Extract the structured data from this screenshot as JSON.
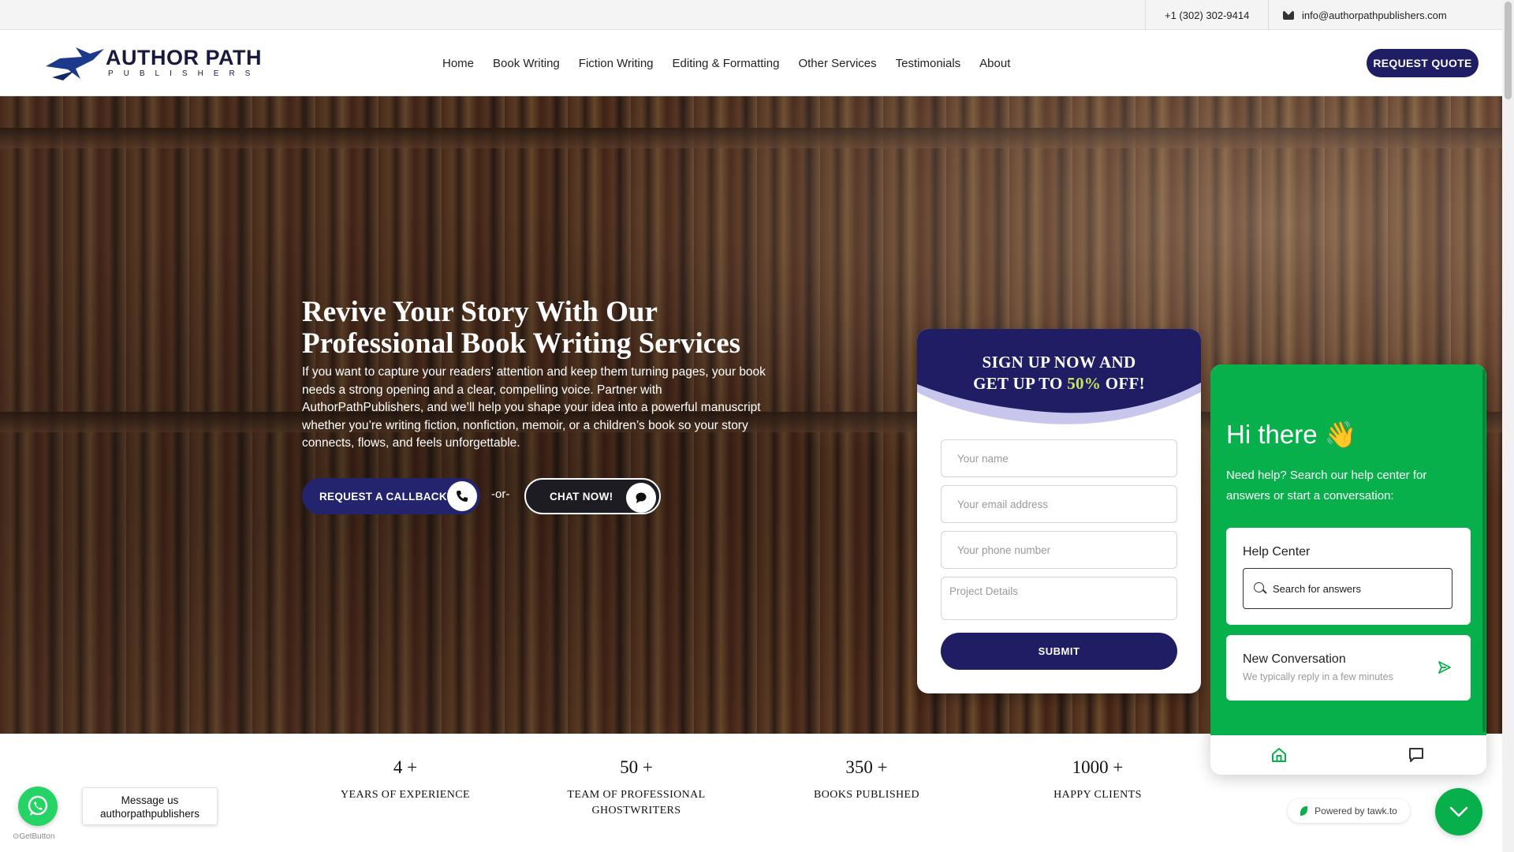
{
  "topbar": {
    "phone": "+1 (302) 302-9414",
    "email": "info@authorpathpublishers.com",
    "email_icon": "envelope-icon"
  },
  "header": {
    "logo_line1": "AUTHOR PATH",
    "logo_line2": "PUBLISHERS",
    "nav": [
      {
        "label": "Home"
      },
      {
        "label": "Book Writing"
      },
      {
        "label": "Fiction Writing"
      },
      {
        "label": "Editing & Formatting"
      },
      {
        "label": "Other Services"
      },
      {
        "label": "Testimonials"
      },
      {
        "label": "About"
      }
    ],
    "quote_button": "REQUEST QUOTE"
  },
  "hero": {
    "title": "Revive Your Story With Our Professional Book Writing Services",
    "description": "If you want to capture your readers’ attention and keep them turning pages, your book needs a strong opening and a clear, compelling voice. Partner with AuthorPathPublishers, and we’ll help you shape your idea into a powerful manuscript whether you’re writing fiction, nonfiction, memoir, or a children’s book so your story connects, flows, and feels unforgettable.",
    "callback_button": "REQUEST A CALLBACK",
    "or_text": "-or-",
    "chat_button": "CHAT NOW!"
  },
  "signup": {
    "title_line1": "SIGN UP NOW AND",
    "title_line2_pre": "GET UP TO ",
    "title_line2_pct": "50%",
    "title_line2_post": " OFF!",
    "name_placeholder": "Your name",
    "email_placeholder": "Your email address",
    "phone_placeholder": "Your phone number",
    "details_placeholder": "Project Details",
    "submit": "SUBMIT",
    "accent_color": "#1f1d63",
    "highlight_color": "#c8e65a"
  },
  "stats": [
    {
      "num": "4 +",
      "label": "YEARS OF EXPERIENCE"
    },
    {
      "num": "50 +",
      "label": "TEAM OF PROFESSIONAL GHOSTWRITERS"
    },
    {
      "num": "350 +",
      "label": "BOOKS PUBLISHED"
    },
    {
      "num": "1000 +",
      "label": "HAPPY CLIENTS"
    }
  ],
  "whatsapp": {
    "message_line1": "Message us",
    "message_line2": "authorpathpublishers",
    "getbutton": "GetButton"
  },
  "tawk": {
    "greeting": "Hi there",
    "wave_emoji": "👋",
    "subtitle": "Need help? Search our help center for answers or start a conversation:",
    "help_center_title": "Help Center",
    "search_placeholder": "Search for answers",
    "new_conversation_title": "New Conversation",
    "new_conversation_sub": "We typically reply in a few minutes",
    "powered_by": "Powered by tawk.to",
    "brand_color": "#08b04b"
  }
}
